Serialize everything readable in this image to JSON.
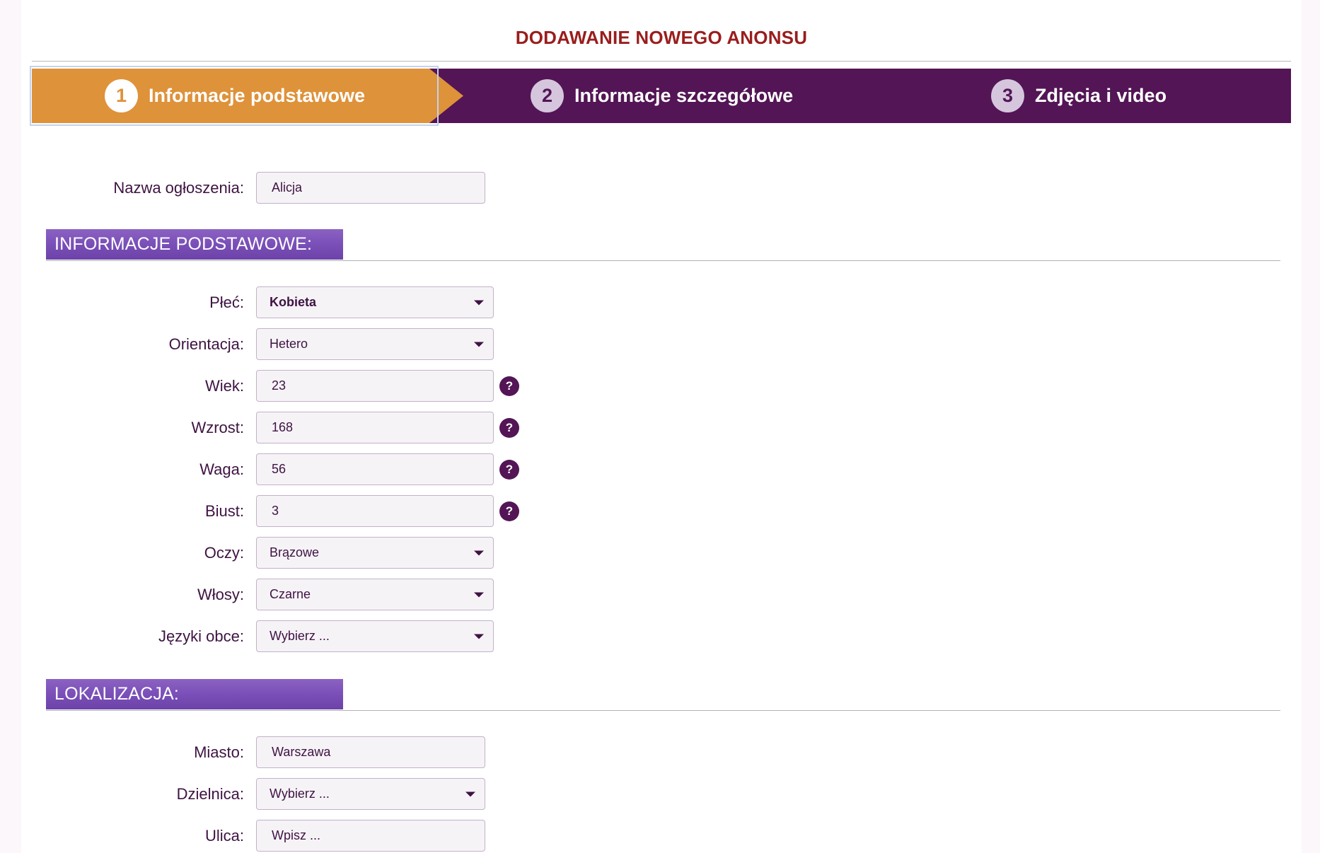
{
  "page": {
    "title": "DODAWANIE NOWEGO ANONSU"
  },
  "steps": [
    {
      "number": "1",
      "label": "Informacje podstawowe",
      "active": true
    },
    {
      "number": "2",
      "label": "Informacje szczegółowe",
      "active": false
    },
    {
      "number": "3",
      "label": "Zdjęcia i video",
      "active": false
    }
  ],
  "ad_name": {
    "label": "Nazwa ogłoszenia:",
    "value": "Alicja"
  },
  "basic_section": {
    "title": "INFORMACJE PODSTAWOWE:",
    "gender": {
      "label": "Płeć:",
      "value": "Kobieta"
    },
    "orientation": {
      "label": "Orientacja:",
      "value": "Hetero"
    },
    "age": {
      "label": "Wiek:",
      "value": "23"
    },
    "height": {
      "label": "Wzrost:",
      "value": "168"
    },
    "weight": {
      "label": "Waga:",
      "value": "56"
    },
    "bust": {
      "label": "Biust:",
      "value": "3"
    },
    "eyes": {
      "label": "Oczy:",
      "value": "Brązowe"
    },
    "hair": {
      "label": "Włosy:",
      "value": "Czarne"
    },
    "languages": {
      "label": "Języki obce:",
      "value": "Wybierz ..."
    },
    "help_glyph": "?"
  },
  "location_section": {
    "title": "LOKALIZACJA:",
    "city": {
      "label": "Miasto:",
      "value": "Warszawa"
    },
    "district": {
      "label": "Dzielnica:",
      "value": "Wybierz ..."
    },
    "street": {
      "label": "Ulica:",
      "placeholder": "Wpisz ..."
    }
  },
  "colors": {
    "active_step": "#de923a",
    "stepper_bg": "#531555",
    "title": "#9a1d1d",
    "section_header": "#7a4fb8",
    "label_text": "#3e1342"
  }
}
